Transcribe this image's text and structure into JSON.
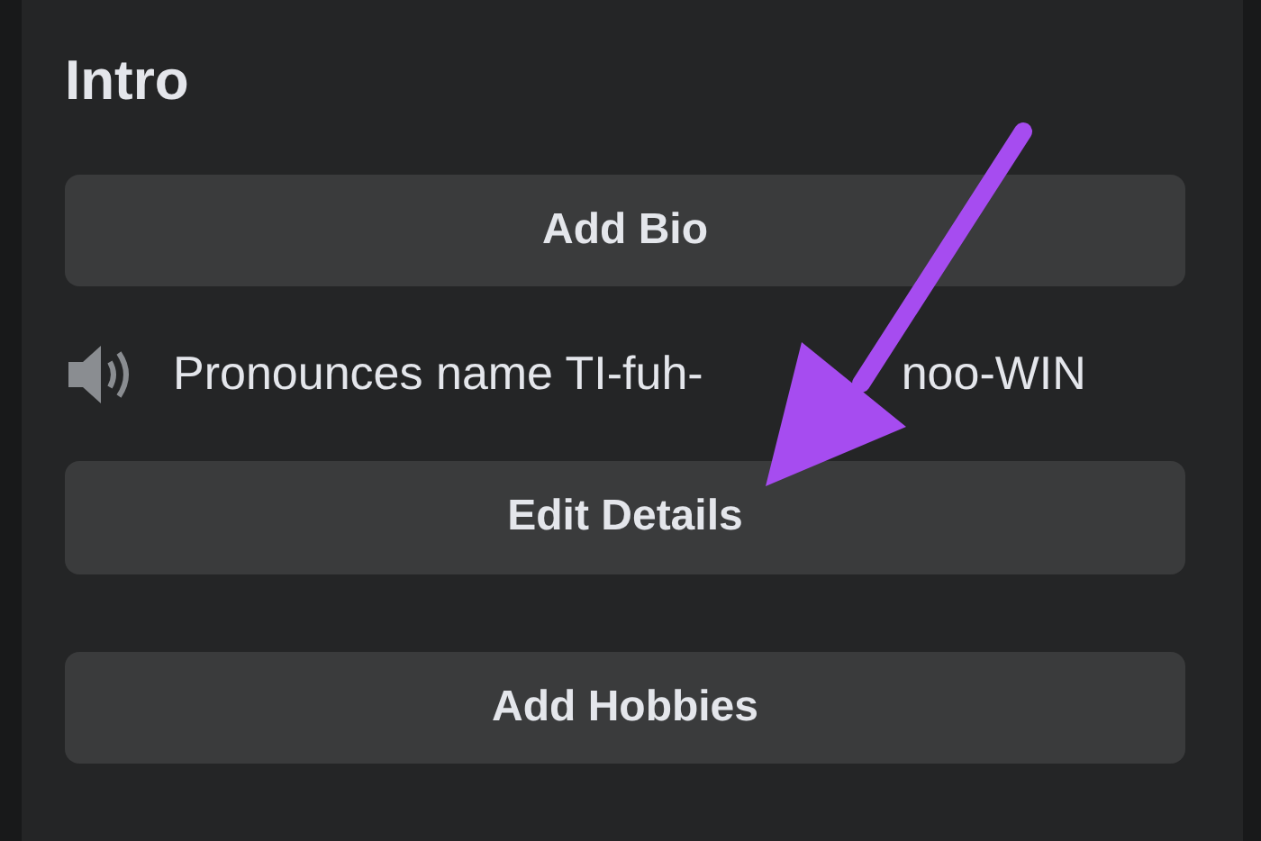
{
  "card": {
    "title": "Intro",
    "buttons": [
      {
        "label": "Add Bio"
      }
    ],
    "pronunciation": {
      "parts": [
        "Pronounces name TI-fuh-",
        "noo-WIN"
      ]
    },
    "more_buttons": [
      {
        "label": "Edit Details"
      },
      {
        "label": "Add Hobbies"
      }
    ]
  }
}
